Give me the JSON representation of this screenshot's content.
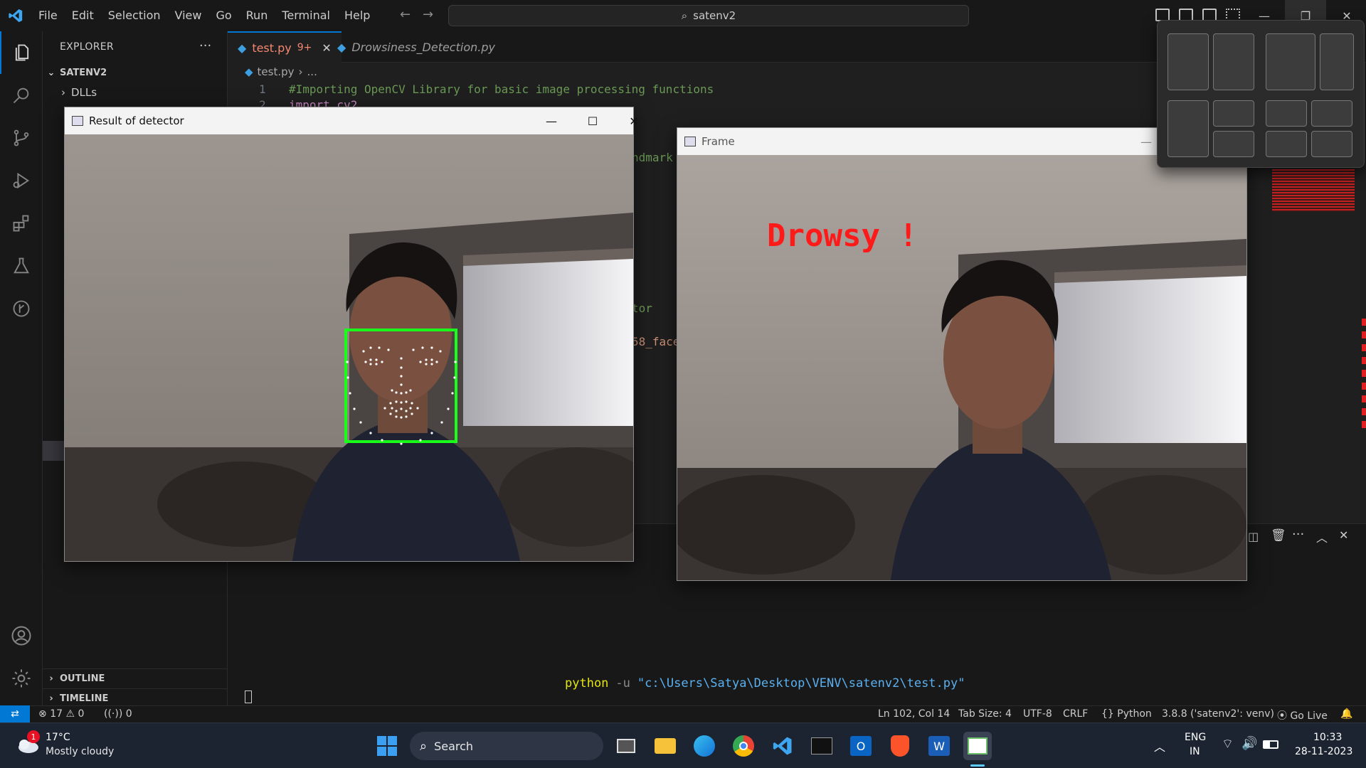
{
  "menu": [
    "File",
    "Edit",
    "Selection",
    "View",
    "Go",
    "Run",
    "Terminal",
    "Help"
  ],
  "command_center": "satenv2",
  "explorer": {
    "title": "EXPLORER",
    "root": "SATENV2",
    "first_item": "DLLs",
    "outline": "OUTLINE",
    "timeline": "TIMELINE"
  },
  "tabs": [
    {
      "label": "test.py",
      "badge": "9+"
    },
    {
      "label": "Drowsiness_Detection.py"
    }
  ],
  "breadcrumb": {
    "file": "test.py",
    "rest": "..."
  },
  "code": {
    "line1_no": "1",
    "line1": "#Importing OpenCV Library for basic image processing functions",
    "line2_no": "2",
    "line2": "import cv2",
    "frag1": "ndmark",
    "frag2": "tor",
    "frag3": "58_face"
  },
  "terminal": {
    "cmd": "python",
    "flag": "-u",
    "path": "\"c:\\Users\\Satya\\Desktop\\VENV\\satenv2\\test.py\""
  },
  "detector_window": {
    "title": "Result of detector"
  },
  "frame_window": {
    "title": "Frame",
    "overlay_text": "Drowsy !"
  },
  "status": {
    "errors": "17",
    "warnings": "0",
    "ports": "0",
    "position": "Ln 102, Col 14",
    "tab_size": "Tab Size: 4",
    "encoding": "UTF-8",
    "eol": "CRLF",
    "language": "Python",
    "interpreter": "3.8.8 ('satenv2': venv)",
    "go_live": "Go Live"
  },
  "taskbar": {
    "weather_temp": "17°C",
    "weather_desc": "Mostly cloudy",
    "weather_badge": "1",
    "search": "Search",
    "lang_top": "ENG",
    "lang_bottom": "IN",
    "time": "10:33",
    "date": "28-11-2023"
  },
  "colors": {
    "accent_blue": "#0078d4",
    "drowsy_red": "#ff1a1a",
    "face_box_green": "#00ff00"
  }
}
